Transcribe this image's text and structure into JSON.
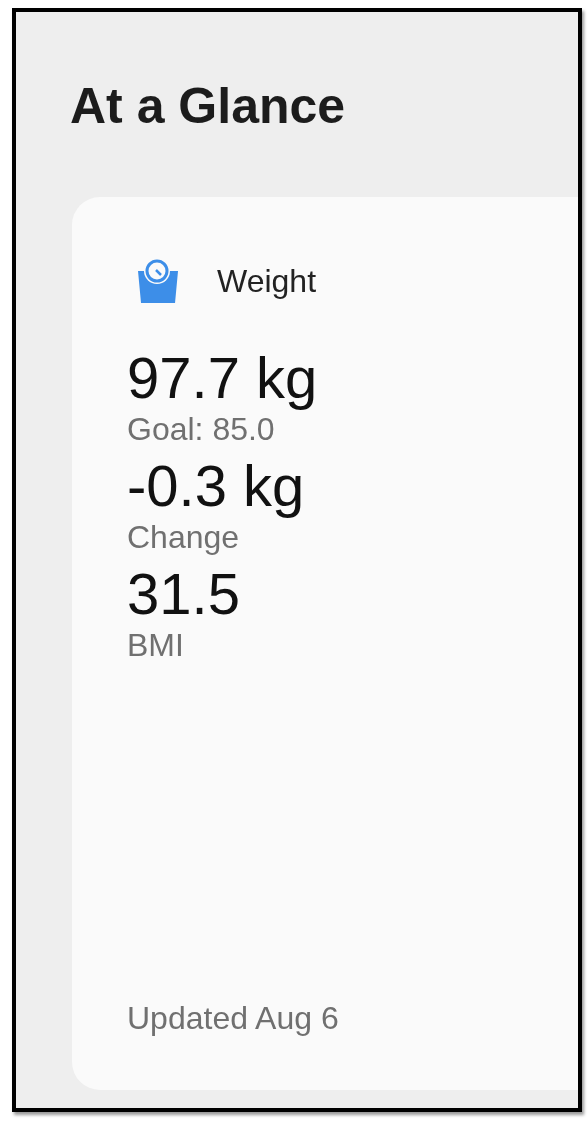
{
  "title": "At a Glance",
  "card": {
    "label": "Weight",
    "metrics": [
      {
        "value": "97.7 kg",
        "caption": "Goal: 85.0"
      },
      {
        "value": "-0.3 kg",
        "caption": "Change"
      },
      {
        "value": "31.5",
        "caption": "BMI"
      }
    ],
    "updated": "Updated Aug 6"
  }
}
